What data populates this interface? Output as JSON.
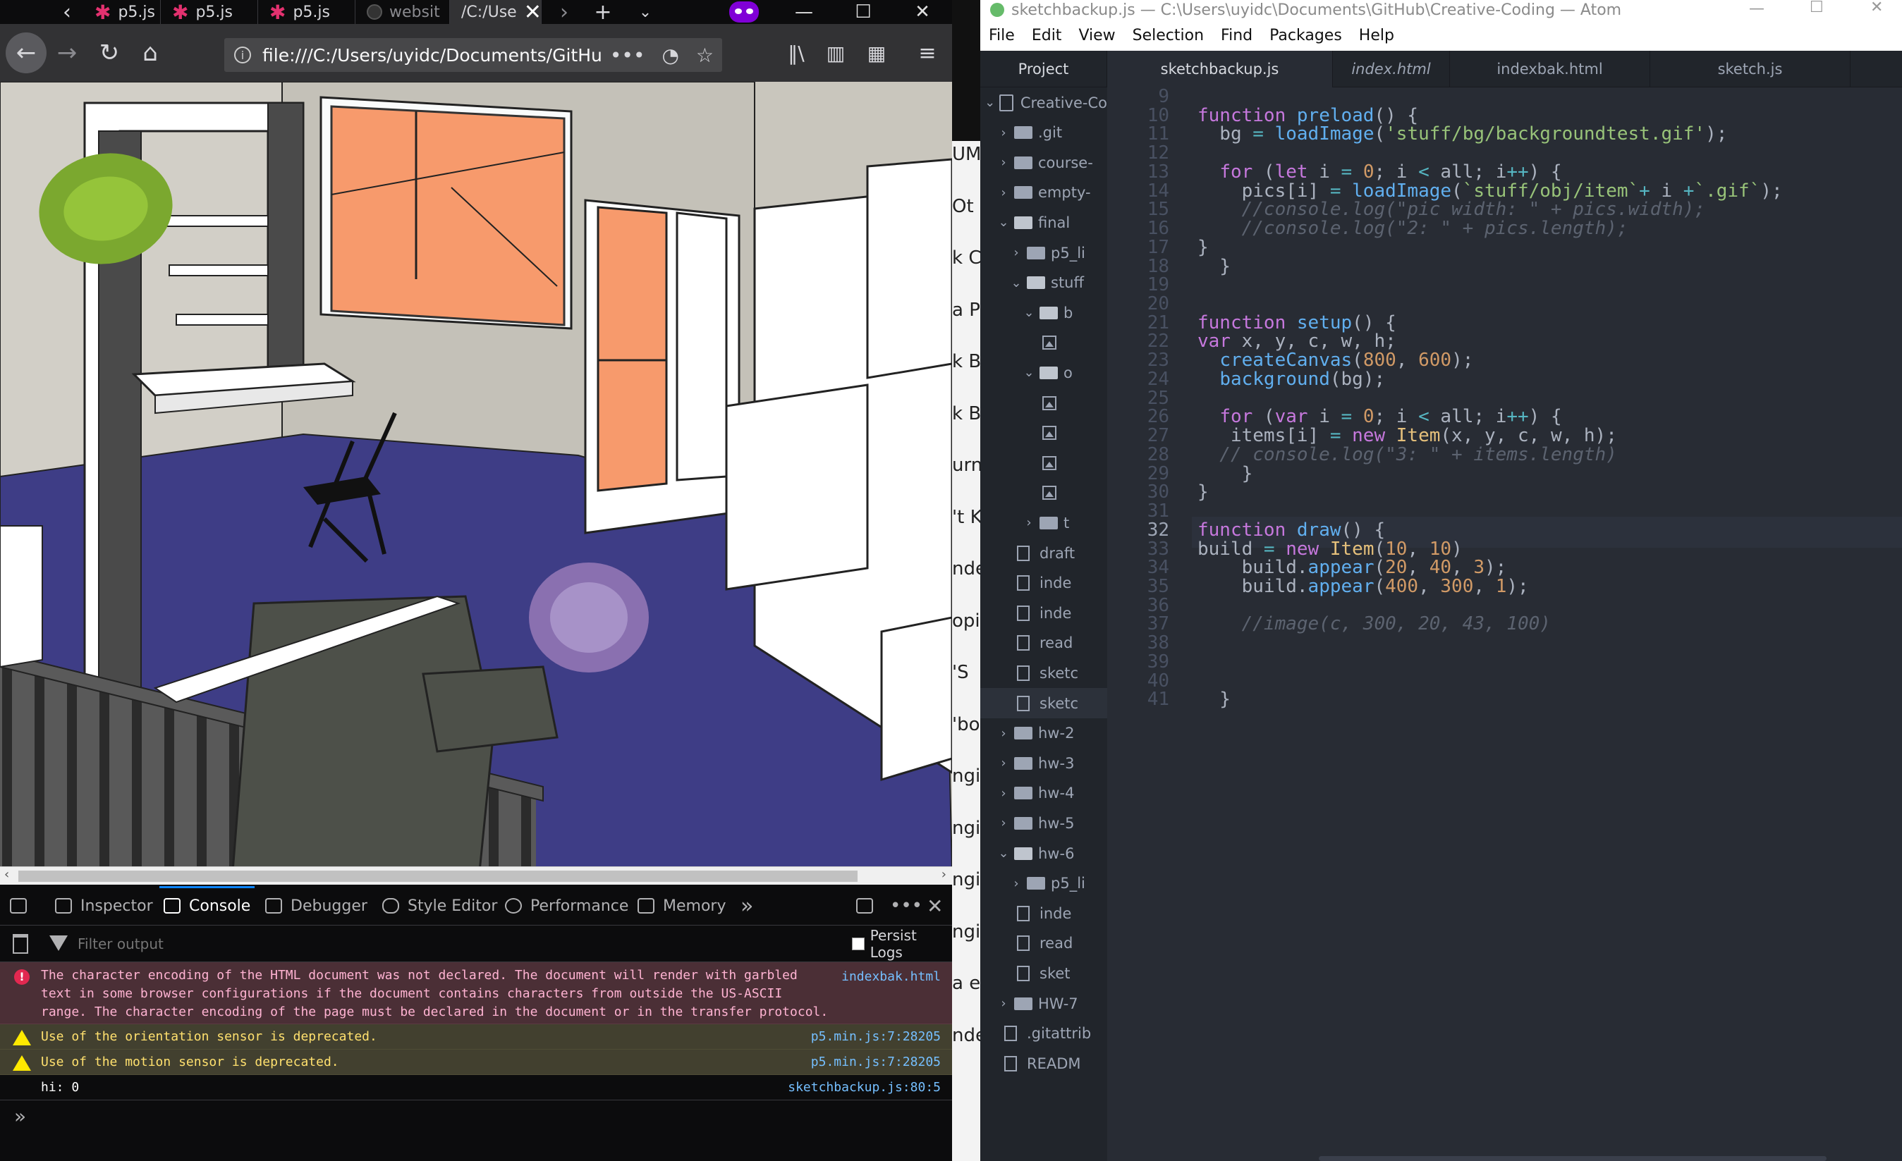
{
  "firefox": {
    "tabs": [
      {
        "label": "p5.js"
      },
      {
        "label": "p5.js"
      },
      {
        "label": "p5.js"
      },
      {
        "label": "websit"
      },
      {
        "label": "/C:/Use"
      }
    ],
    "url": "file:///C:/Users/uyidc/Documents/GitHu",
    "page_action": "•••",
    "devtools": {
      "tabs": [
        "Inspector",
        "Console",
        "Debugger",
        "Style Editor",
        "Performance",
        "Memory"
      ],
      "active_tab": "Console",
      "filter_placeholder": "Filter output",
      "persist_logs": "Persist Logs",
      "messages": [
        {
          "type": "error",
          "text": "The character encoding of the HTML document was not declared. The document will render with garbled\ntext in some browser configurations if the document contains characters from outside the US-ASCII\nrange. The character encoding of the page must be declared in the document or in the transfer protocol.",
          "source": "indexbak.html"
        },
        {
          "type": "warning",
          "text": "Use of the orientation sensor is deprecated.",
          "source": "p5.min.js:7:28205"
        },
        {
          "type": "warning",
          "text": "Use of the motion sensor is deprecated.",
          "source": "p5.min.js:7:28205"
        },
        {
          "type": "log",
          "text": "hi: 0",
          "source": "sketchbackup.js:80:5"
        }
      ],
      "prompt": "»"
    }
  },
  "background_window": {
    "fragments": [
      "UM",
      "Ot",
      "k C",
      "a P",
      "k B",
      "k B",
      "urn",
      "'t K",
      "nde",
      "opi",
      "'S",
      "'bo",
      "ngi",
      "ngi",
      "ngi",
      "ngi",
      "a e",
      "nde"
    ]
  },
  "atom": {
    "title": "sketchbackup.js — C:\\Users\\uyidc\\Documents\\GitHub\\Creative-Coding — Atom",
    "menu": [
      "File",
      "Edit",
      "View",
      "Selection",
      "Find",
      "Packages",
      "Help"
    ],
    "tabs": [
      {
        "label": "Project"
      },
      {
        "label": "sketchbackup.js"
      },
      {
        "label": "index.html"
      },
      {
        "label": "indexbak.html"
      },
      {
        "label": "sketch.js"
      }
    ],
    "tree": [
      {
        "label": "Creative-Co",
        "kind": "repo",
        "indent": 0,
        "open": true
      },
      {
        "label": ".git",
        "kind": "folder",
        "indent": 1
      },
      {
        "label": "course-",
        "kind": "folder",
        "indent": 1
      },
      {
        "label": "empty-",
        "kind": "folder",
        "indent": 1
      },
      {
        "label": "final",
        "kind": "folder",
        "indent": 1,
        "open": true
      },
      {
        "label": "p5_li",
        "kind": "folder",
        "indent": 2
      },
      {
        "label": "stuff",
        "kind": "folder",
        "indent": 2,
        "open": true
      },
      {
        "label": "b",
        "kind": "folder",
        "indent": 3,
        "open": true
      },
      {
        "label": "",
        "kind": "image",
        "indent": 4
      },
      {
        "label": "o",
        "kind": "folder",
        "indent": 3,
        "open": true
      },
      {
        "label": "",
        "kind": "image",
        "indent": 4
      },
      {
        "label": "",
        "kind": "image",
        "indent": 4
      },
      {
        "label": "",
        "kind": "image",
        "indent": 4
      },
      {
        "label": "",
        "kind": "image",
        "indent": 4
      },
      {
        "label": "t",
        "kind": "folder",
        "indent": 3
      },
      {
        "label": "draft",
        "kind": "file",
        "indent": 2
      },
      {
        "label": "inde",
        "kind": "file",
        "indent": 2
      },
      {
        "label": "inde",
        "kind": "file",
        "indent": 2
      },
      {
        "label": "read",
        "kind": "file",
        "indent": 2
      },
      {
        "label": "sketc",
        "kind": "file",
        "indent": 2
      },
      {
        "label": "sketc",
        "kind": "file",
        "indent": 2,
        "selected": true
      },
      {
        "label": "hw-2",
        "kind": "folder",
        "indent": 1
      },
      {
        "label": "hw-3",
        "kind": "folder",
        "indent": 1
      },
      {
        "label": "hw-4",
        "kind": "folder",
        "indent": 1
      },
      {
        "label": "hw-5",
        "kind": "folder",
        "indent": 1
      },
      {
        "label": "hw-6",
        "kind": "folder",
        "indent": 1,
        "open": true
      },
      {
        "label": "p5_li",
        "kind": "folder",
        "indent": 2
      },
      {
        "label": "inde",
        "kind": "file",
        "indent": 2
      },
      {
        "label": "read",
        "kind": "file",
        "indent": 2
      },
      {
        "label": "sket",
        "kind": "file",
        "indent": 2
      },
      {
        "label": "HW-7",
        "kind": "folder",
        "indent": 1
      },
      {
        "label": ".gitattrib",
        "kind": "file",
        "indent": 1
      },
      {
        "label": "READM",
        "kind": "file",
        "indent": 1
      }
    ],
    "current_line": 32,
    "code": [
      {
        "n": 9,
        "segs": []
      },
      {
        "n": 10,
        "segs": [
          [
            "k",
            "function "
          ],
          [
            "f",
            "preload"
          ],
          [
            "v",
            "() {"
          ]
        ]
      },
      {
        "n": 11,
        "segs": [
          [
            "v",
            "  bg "
          ],
          [
            "o",
            "="
          ],
          [
            "v",
            " "
          ],
          [
            "f",
            "loadImage"
          ],
          [
            "v",
            "("
          ],
          [
            "s",
            "'stuff/bg/backgroundtest.gif'"
          ],
          [
            "v",
            ");"
          ]
        ]
      },
      {
        "n": 12,
        "segs": []
      },
      {
        "n": 13,
        "segs": [
          [
            "v",
            "  "
          ],
          [
            "k",
            "for"
          ],
          [
            "v",
            " ("
          ],
          [
            "k",
            "let"
          ],
          [
            "v",
            " i "
          ],
          [
            "o",
            "="
          ],
          [
            "v",
            " "
          ],
          [
            "n",
            "0"
          ],
          [
            "v",
            "; i "
          ],
          [
            "o",
            "<"
          ],
          [
            "v",
            " all; i"
          ],
          [
            "o",
            "++"
          ],
          [
            "v",
            ") {"
          ]
        ]
      },
      {
        "n": 14,
        "segs": [
          [
            "v",
            "    pics[i] "
          ],
          [
            "o",
            "="
          ],
          [
            "v",
            " "
          ],
          [
            "f",
            "loadImage"
          ],
          [
            "v",
            "("
          ],
          [
            "s",
            "`stuff/obj/item`"
          ],
          [
            "o",
            "+"
          ],
          [
            "v",
            " i "
          ],
          [
            "o",
            "+"
          ],
          [
            "s",
            "`.gif`"
          ],
          [
            "v",
            ");"
          ]
        ]
      },
      {
        "n": 15,
        "segs": [
          [
            "c",
            "    //console.log(\"pic width: \" + pics.width);"
          ]
        ]
      },
      {
        "n": 16,
        "segs": [
          [
            "c",
            "    //console.log(\"2: \" + pics.length);"
          ]
        ]
      },
      {
        "n": 17,
        "segs": [
          [
            "v",
            "}"
          ]
        ]
      },
      {
        "n": 18,
        "segs": [
          [
            "v",
            "  }"
          ]
        ]
      },
      {
        "n": 19,
        "segs": []
      },
      {
        "n": 20,
        "segs": []
      },
      {
        "n": 21,
        "segs": [
          [
            "k",
            "function "
          ],
          [
            "f",
            "setup"
          ],
          [
            "v",
            "() {"
          ]
        ]
      },
      {
        "n": 22,
        "segs": [
          [
            "k",
            "var"
          ],
          [
            "v",
            " x, y, c, w, h;"
          ]
        ]
      },
      {
        "n": 23,
        "segs": [
          [
            "v",
            "  "
          ],
          [
            "f",
            "createCanvas"
          ],
          [
            "v",
            "("
          ],
          [
            "n",
            "800"
          ],
          [
            "v",
            ", "
          ],
          [
            "n",
            "600"
          ],
          [
            "v",
            ");"
          ]
        ]
      },
      {
        "n": 24,
        "segs": [
          [
            "v",
            "  "
          ],
          [
            "f",
            "background"
          ],
          [
            "v",
            "(bg);"
          ]
        ]
      },
      {
        "n": 25,
        "segs": []
      },
      {
        "n": 26,
        "segs": [
          [
            "v",
            "  "
          ],
          [
            "k",
            "for"
          ],
          [
            "v",
            " ("
          ],
          [
            "k",
            "var"
          ],
          [
            "v",
            " i "
          ],
          [
            "o",
            "="
          ],
          [
            "v",
            " "
          ],
          [
            "n",
            "0"
          ],
          [
            "v",
            "; i "
          ],
          [
            "o",
            "<"
          ],
          [
            "v",
            " all; i"
          ],
          [
            "o",
            "++"
          ],
          [
            "v",
            ") {"
          ]
        ]
      },
      {
        "n": 27,
        "segs": [
          [
            "v",
            "   items[i] "
          ],
          [
            "o",
            "="
          ],
          [
            "v",
            " "
          ],
          [
            "k",
            "new"
          ],
          [
            "v",
            " "
          ],
          [
            "t",
            "Item"
          ],
          [
            "v",
            "(x, y, c, w, h);"
          ]
        ]
      },
      {
        "n": 28,
        "segs": [
          [
            "c",
            "  // console.log(\"3: \" + items.length)"
          ]
        ]
      },
      {
        "n": 29,
        "segs": [
          [
            "v",
            "    }"
          ]
        ]
      },
      {
        "n": 30,
        "segs": [
          [
            "v",
            "}"
          ]
        ]
      },
      {
        "n": 31,
        "segs": []
      },
      {
        "n": 32,
        "segs": [
          [
            "k",
            "function "
          ],
          [
            "f",
            "draw"
          ],
          [
            "v",
            "() {"
          ]
        ]
      },
      {
        "n": 33,
        "segs": [
          [
            "v",
            "build "
          ],
          [
            "o",
            "="
          ],
          [
            "v",
            " "
          ],
          [
            "k",
            "new"
          ],
          [
            "v",
            " "
          ],
          [
            "t",
            "Item"
          ],
          [
            "v",
            "("
          ],
          [
            "n",
            "10"
          ],
          [
            "v",
            ", "
          ],
          [
            "n",
            "10"
          ],
          [
            "v",
            ")"
          ]
        ]
      },
      {
        "n": 34,
        "segs": [
          [
            "v",
            "    build."
          ],
          [
            "f",
            "appear"
          ],
          [
            "v",
            "("
          ],
          [
            "n",
            "20"
          ],
          [
            "v",
            ", "
          ],
          [
            "n",
            "40"
          ],
          [
            "v",
            ", "
          ],
          [
            "n",
            "3"
          ],
          [
            "v",
            ");"
          ]
        ]
      },
      {
        "n": 35,
        "segs": [
          [
            "v",
            "    build."
          ],
          [
            "f",
            "appear"
          ],
          [
            "v",
            "("
          ],
          [
            "n",
            "400"
          ],
          [
            "v",
            ", "
          ],
          [
            "n",
            "300"
          ],
          [
            "v",
            ", "
          ],
          [
            "n",
            "1"
          ],
          [
            "v",
            ");"
          ]
        ]
      },
      {
        "n": 36,
        "segs": []
      },
      {
        "n": 37,
        "segs": [
          [
            "c",
            "    //image(c, 300, 20, 43, 100)"
          ]
        ]
      },
      {
        "n": 38,
        "segs": []
      },
      {
        "n": 39,
        "segs": []
      },
      {
        "n": 40,
        "segs": []
      },
      {
        "n": 41,
        "segs": [
          [
            "v",
            "  }"
          ]
        ]
      }
    ]
  }
}
